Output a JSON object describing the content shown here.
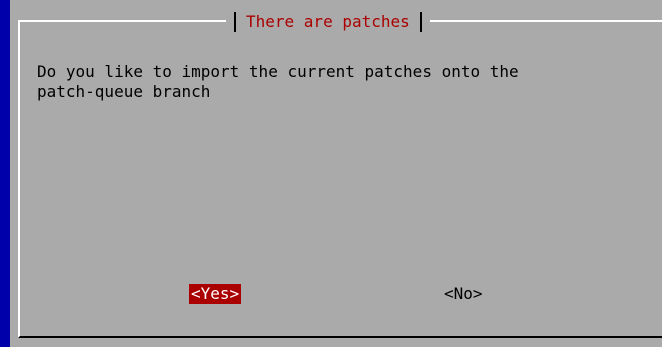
{
  "dialog": {
    "title": "There are patches",
    "message": "Do you like to import the current patches onto the\npatch-queue branch",
    "buttons": {
      "yes": "<Yes>",
      "no": "<No>"
    }
  },
  "colors": {
    "background": "#0000aa",
    "dialog": "#aaaaaa",
    "title_text": "#aa0000",
    "selected_button_bg": "#aa0000",
    "selected_button_text": "#ffffff"
  }
}
